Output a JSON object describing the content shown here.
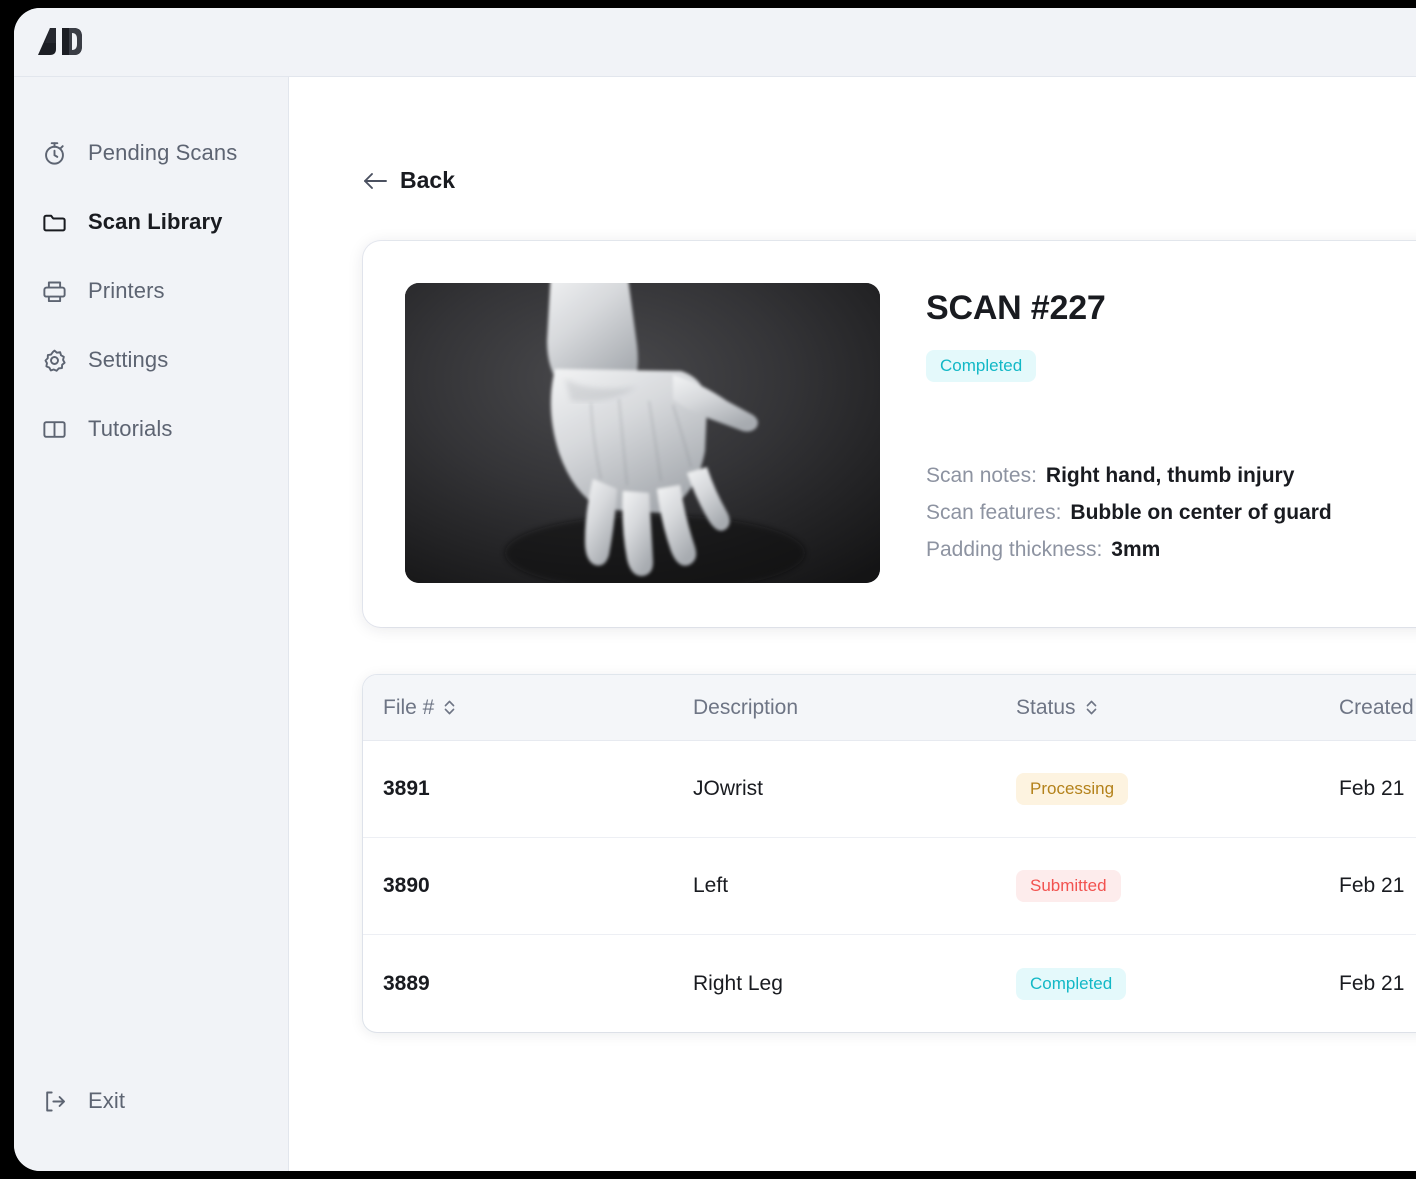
{
  "app": {
    "logo_name": "jo-logo"
  },
  "sidebar": {
    "items": [
      {
        "label": "Pending Scans",
        "icon": "stopwatch-icon",
        "active": false
      },
      {
        "label": "Scan Library",
        "icon": "folder-icon",
        "active": true
      },
      {
        "label": "Printers",
        "icon": "printer-icon",
        "active": false
      },
      {
        "label": "Settings",
        "icon": "gear-icon",
        "active": false
      },
      {
        "label": "Tutorials",
        "icon": "book-icon",
        "active": false
      }
    ],
    "exit": {
      "label": "Exit",
      "icon": "exit-icon"
    }
  },
  "main": {
    "back_label": "Back",
    "back_icon": "arrow-left-icon"
  },
  "detail": {
    "title": "SCAN #227",
    "status": "Completed",
    "thumbnail_alt": "3D scan render of a right hand",
    "meta": [
      {
        "label": "Scan notes:",
        "value": "Right hand, thumb injury"
      },
      {
        "label": "Scan features:",
        "value": "Bubble on center of guard"
      },
      {
        "label": "Padding thickness:",
        "value": "3mm"
      }
    ]
  },
  "table": {
    "columns": [
      {
        "label": "File #",
        "sortable": true
      },
      {
        "label": "Description",
        "sortable": false
      },
      {
        "label": "Status",
        "sortable": true
      },
      {
        "label": "Created",
        "sortable": false
      }
    ],
    "rows": [
      {
        "file": "3891",
        "description": "JOwrist",
        "status": "Processing",
        "created": "Feb 21"
      },
      {
        "file": "3890",
        "description": "Left",
        "status": "Submitted",
        "created": "Feb 21"
      },
      {
        "file": "3889",
        "description": "Right Leg",
        "status": "Completed",
        "created": "Feb 21"
      }
    ]
  },
  "colors": {
    "status_completed_text": "#12B8C6",
    "status_completed_bg": "#E4F9FB",
    "status_processing_text": "#B4821B",
    "status_processing_bg": "#FDF3E0",
    "status_submitted_text": "#F2524F",
    "status_submitted_bg": "#FDECEC",
    "sidebar_bg": "#F1F3F7",
    "main_bg": "#FFFFFF",
    "text_primary": "#191B20",
    "text_muted": "#6E7585"
  }
}
